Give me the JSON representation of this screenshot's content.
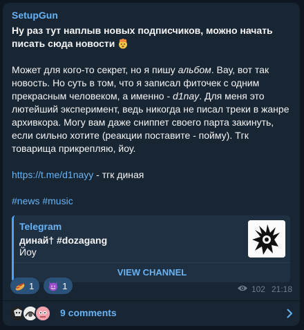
{
  "post": {
    "channel_name": "SetupGun",
    "headline": "Ну раз тут наплыв новых подписчиков, можно начать писать сюда новости",
    "headline_emoji": "mind-blown-emoji",
    "paragraph": {
      "p1": "Может для кого-то секрет, но я пишу ",
      "em1": "альбом",
      "p2": ". Вау, вот так новость. Но суть в том, что я записал фиточек с одним прекрасным человеком, а именно - ",
      "em2": "d1nay",
      "p3": ". Для меня это лютейший эксперимент, ведь никогда не писал треки в жанре архивкора. Могу вам даже сниппет своего парта закинуть, если сильно хотите (реакции поставите - пойму). Тгк товарища прикрепляю, йоу."
    },
    "link": "https://t.me/d1nayy",
    "link_suffix": " - тгк диная",
    "hashtags": [
      "#news",
      "#music"
    ]
  },
  "preview": {
    "source": "Telegram",
    "title": "динай† #dozagang",
    "description": "Йоу",
    "button_label": "VIEW CHANNEL"
  },
  "reactions": [
    {
      "emoji": "hotdog-emoji",
      "count": "1"
    },
    {
      "emoji": "smiling-devil-emoji",
      "count": "1"
    }
  ],
  "meta": {
    "views": "102",
    "time": "21:18"
  },
  "comments": {
    "label": "9 comments"
  },
  "colors": {
    "accent": "#6ab3f3",
    "bubble": "#182533",
    "background": "#0e1621",
    "reaction_bg": "#2b5278"
  }
}
